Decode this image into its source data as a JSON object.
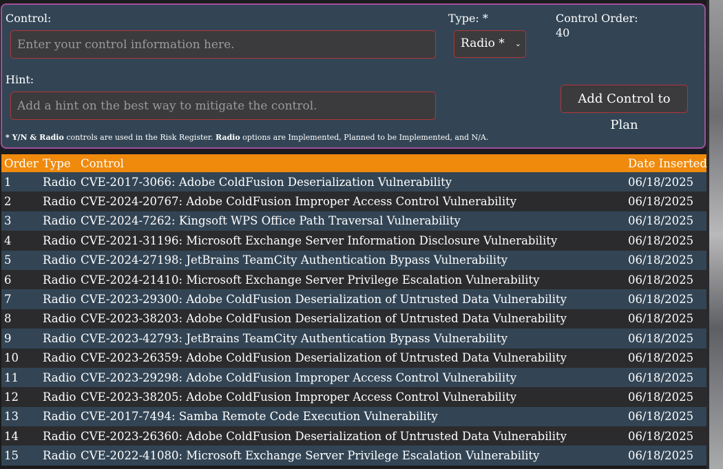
{
  "form": {
    "control_label": "Control:",
    "control_placeholder": "Enter your control information here.",
    "type_label": "Type: *",
    "type_selected": "Radio *",
    "order_label": "Control Order:",
    "order_value": "40",
    "hint_label": "Hint:",
    "hint_placeholder": "Add a hint on the best way to mitigate the control.",
    "add_button": "Add Control to Plan",
    "note": {
      "part1": "* Y/N & Radio",
      "part2": " controls are used in the Risk Register. ",
      "part3": "Radio",
      "part4": " options are Implemented, Planned to be Implemented, and N/A."
    }
  },
  "table": {
    "headers": {
      "order": "Order",
      "type": "Type",
      "control": "Control",
      "date": "Date Inserted"
    },
    "rows": [
      {
        "order": "1",
        "type": "Radio",
        "control": "CVE-2017-3066: Adobe ColdFusion Deserialization Vulnerability",
        "date": "06/18/2025"
      },
      {
        "order": "2",
        "type": "Radio",
        "control": "CVE-2024-20767: Adobe ColdFusion Improper Access Control Vulnerability",
        "date": "06/18/2025"
      },
      {
        "order": "3",
        "type": "Radio",
        "control": "CVE-2024-7262: Kingsoft WPS Office Path Traversal Vulnerability",
        "date": "06/18/2025"
      },
      {
        "order": "4",
        "type": "Radio",
        "control": "CVE-2021-31196: Microsoft Exchange Server Information Disclosure Vulnerability",
        "date": "06/18/2025"
      },
      {
        "order": "5",
        "type": "Radio",
        "control": "CVE-2024-27198: JetBrains TeamCity Authentication Bypass Vulnerability",
        "date": "06/18/2025"
      },
      {
        "order": "6",
        "type": "Radio",
        "control": "CVE-2024-21410: Microsoft Exchange Server Privilege Escalation Vulnerability",
        "date": "06/18/2025"
      },
      {
        "order": "7",
        "type": "Radio",
        "control": "CVE-2023-29300: Adobe ColdFusion Deserialization of Untrusted Data Vulnerability",
        "date": "06/18/2025"
      },
      {
        "order": "8",
        "type": "Radio",
        "control": "CVE-2023-38203: Adobe ColdFusion Deserialization of Untrusted Data Vulnerability",
        "date": "06/18/2025"
      },
      {
        "order": "9",
        "type": "Radio",
        "control": "CVE-2023-42793: JetBrains TeamCity Authentication Bypass Vulnerability",
        "date": "06/18/2025"
      },
      {
        "order": "10",
        "type": "Radio",
        "control": "CVE-2023-26359: Adobe ColdFusion Deserialization of Untrusted Data Vulnerability",
        "date": "06/18/2025"
      },
      {
        "order": "11",
        "type": "Radio",
        "control": "CVE-2023-29298: Adobe ColdFusion Improper Access Control Vulnerability",
        "date": "06/18/2025"
      },
      {
        "order": "12",
        "type": "Radio",
        "control": "CVE-2023-38205: Adobe ColdFusion Improper Access Control Vulnerability",
        "date": "06/18/2025"
      },
      {
        "order": "13",
        "type": "Radio",
        "control": "CVE-2017-7494: Samba Remote Code Execution Vulnerability",
        "date": "06/18/2025"
      },
      {
        "order": "14",
        "type": "Radio",
        "control": "CVE-2023-26360: Adobe ColdFusion Deserialization of Untrusted Data Vulnerability",
        "date": "06/18/2025"
      },
      {
        "order": "15",
        "type": "Radio",
        "control": "CVE-2022-41080: Microsoft Exchange Server Privilege Escalation Vulnerability",
        "date": "06/18/2025"
      }
    ]
  },
  "icons": {
    "select_chevron": "chevron-down-icon"
  },
  "colors": {
    "panel_bg": "#334555",
    "panel_border": "#a34f9e",
    "input_border": "#b53438",
    "header_bg": "#ef8a0d",
    "row_odd": "#334555",
    "row_even": "#2b2b2d"
  }
}
